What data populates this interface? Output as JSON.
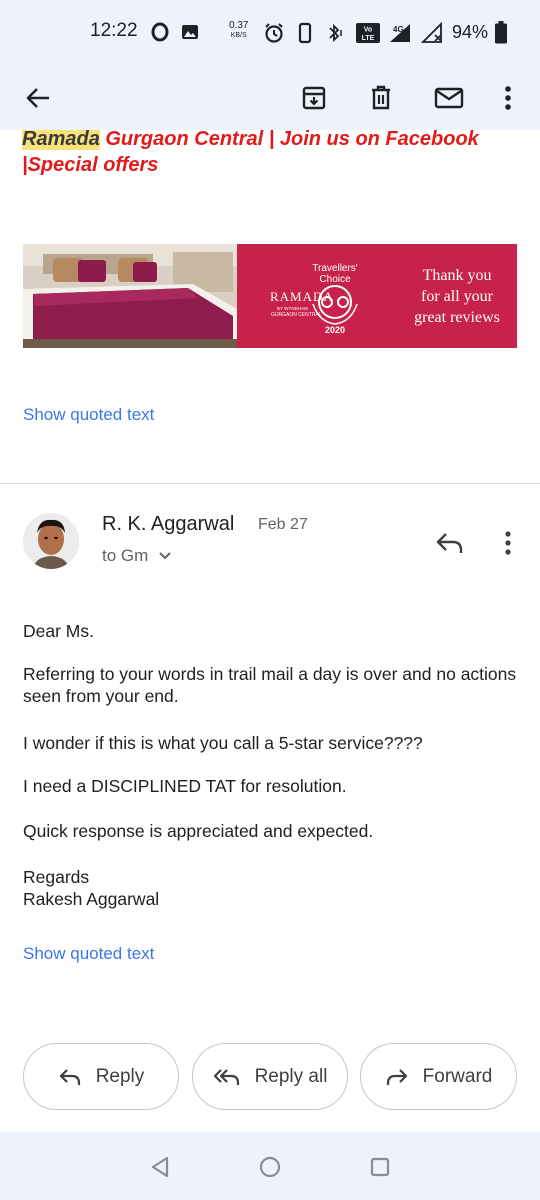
{
  "status_bar": {
    "time": "12:22",
    "speed_value": "0.37",
    "speed_unit": "KB/S",
    "volte": "VoLTE",
    "network": "4G",
    "battery": "94%"
  },
  "app_bar": {
    "icons": [
      "back-arrow-icon",
      "archive-icon",
      "delete-icon",
      "mark-unread-icon",
      "more-vert-icon"
    ]
  },
  "previous_message": {
    "heading_highlight": "Ramada",
    "heading_rest": " Gurgaon Central | Join us on Facebook |Special offers",
    "banner": {
      "brand": "RAMADA",
      "brand_sub": "BY WYNDHAM",
      "brand_loc": "GURGAON CENTRAL",
      "award_line1": "Travellers'",
      "award_line2": "Choice",
      "award_year": "2020",
      "thanks": [
        "Thank you",
        "for all your",
        "great reviews"
      ],
      "colors": {
        "bg": "#c8224a",
        "text": "#ffffff"
      }
    },
    "show_quoted": "Show quoted text"
  },
  "message": {
    "sender": "R. K. Aggarwal",
    "date": "Feb 27",
    "to": "to Gm",
    "paragraphs": [
      "Dear Ms.",
      "Referring to your words in trail mail a day is over and no actions seen from your end.",
      "I wonder if this is what you call a 5-star service????",
      "I need a DISCIPLINED TAT for resolution.",
      "Quick response is appreciated and expected.",
      "Regards",
      "Rakesh Aggarwal"
    ],
    "show_quoted": "Show quoted text"
  },
  "actions": {
    "reply": "Reply",
    "reply_all": "Reply all",
    "forward": "Forward"
  },
  "colors": {
    "link": "#3b78e7",
    "header_bg": "#eef2fb",
    "accent_red": "#e31a1a"
  }
}
